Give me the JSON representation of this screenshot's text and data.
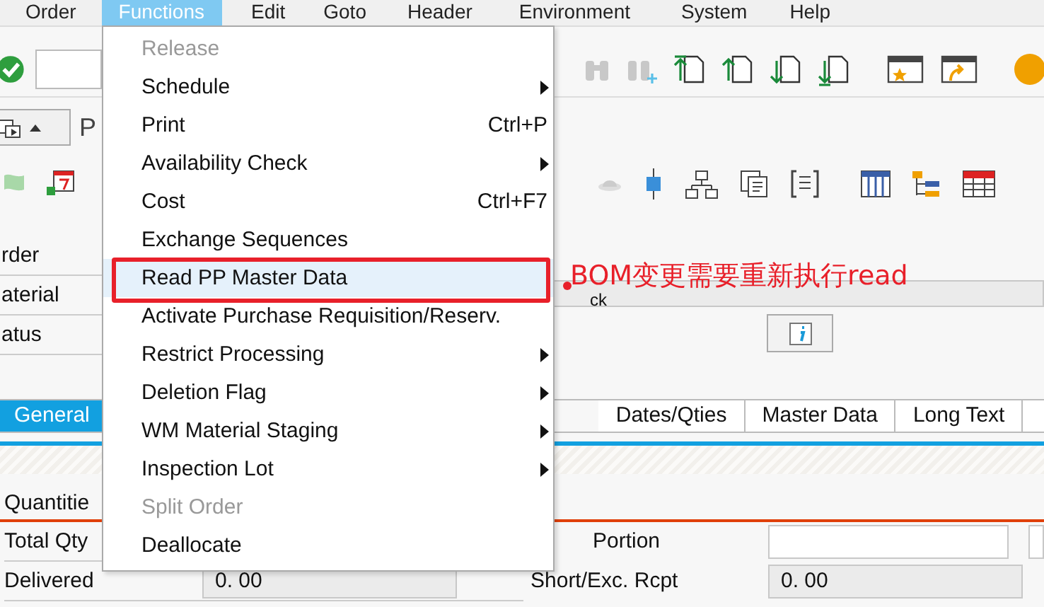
{
  "menu_bar": [
    {
      "label": "Order",
      "selected": false
    },
    {
      "label": "Functions",
      "selected": true
    },
    {
      "label": "Edit",
      "selected": false
    },
    {
      "label": "Goto",
      "selected": false
    },
    {
      "label": "Header",
      "selected": false
    },
    {
      "label": "Environment",
      "selected": false
    },
    {
      "label": "System",
      "selected": false
    },
    {
      "label": "Help",
      "selected": false
    }
  ],
  "screen_title": "P",
  "header_fields": [
    {
      "label": "rder"
    },
    {
      "label": "aterial"
    },
    {
      "label": "atus"
    }
  ],
  "check_field": "ck",
  "tabs": [
    {
      "label": "General",
      "selected": true
    },
    {
      "label": "Dates/Qties",
      "selected": false
    },
    {
      "label": "Master Data",
      "selected": false
    },
    {
      "label": "Long Text",
      "selected": false
    }
  ],
  "quantities": {
    "title": "Quantitie",
    "left": [
      {
        "label": "Total Qty"
      },
      {
        "label": "Delivered",
        "value": "0. 00"
      }
    ],
    "right": [
      {
        "label": "Portion",
        "kind": "input"
      },
      {
        "label": "Short/Exc. Rcpt",
        "kind": "value",
        "value": "0. 00"
      }
    ]
  },
  "dropdown": {
    "items": [
      {
        "label": "Release",
        "kind": "item",
        "disabled": true,
        "selected": false
      },
      {
        "label": "Schedule",
        "kind": "submenu",
        "disabled": false,
        "selected": false
      },
      {
        "label": "Print",
        "kind": "item",
        "shortcut": "Ctrl+P",
        "disabled": false,
        "selected": false
      },
      {
        "label": "Availability Check",
        "kind": "submenu",
        "disabled": false,
        "selected": false
      },
      {
        "label": "Cost",
        "kind": "item",
        "shortcut": "Ctrl+F7",
        "disabled": false,
        "selected": false
      },
      {
        "label": "Exchange Sequences",
        "kind": "item",
        "disabled": false,
        "selected": false
      },
      {
        "label": "Read PP Master Data",
        "kind": "item",
        "disabled": false,
        "selected": true
      },
      {
        "label": "Activate Purchase Requisition/Reserv.",
        "kind": "item",
        "disabled": false,
        "selected": false
      },
      {
        "label": "Restrict Processing",
        "kind": "submenu",
        "disabled": false,
        "selected": false
      },
      {
        "label": "Deletion Flag",
        "kind": "submenu",
        "disabled": false,
        "selected": false
      },
      {
        "label": "WM Material Staging",
        "kind": "submenu",
        "disabled": false,
        "selected": false
      },
      {
        "label": "Inspection Lot",
        "kind": "submenu",
        "disabled": false,
        "selected": false
      },
      {
        "label": "Split Order",
        "kind": "item",
        "disabled": true,
        "selected": false
      },
      {
        "label": "Deallocate",
        "kind": "item",
        "disabled": false,
        "selected": false
      }
    ]
  },
  "annotation": {
    "text": "BOM变更需要重新执行read"
  }
}
